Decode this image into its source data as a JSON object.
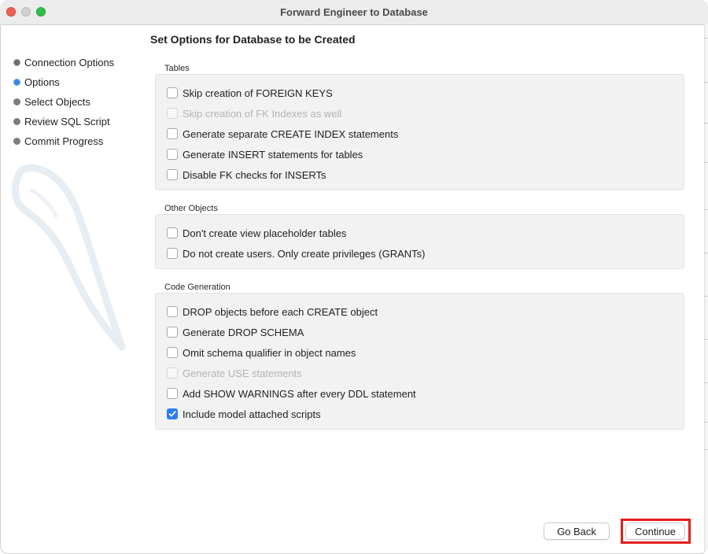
{
  "window": {
    "title": "Forward Engineer to Database"
  },
  "sidebar": {
    "steps": [
      {
        "label": "Connection Options",
        "state": "done"
      },
      {
        "label": "Options",
        "state": "current"
      },
      {
        "label": "Select Objects",
        "state": "pending"
      },
      {
        "label": "Review SQL Script",
        "state": "pending"
      },
      {
        "label": "Commit Progress",
        "state": "pending"
      }
    ]
  },
  "main": {
    "heading": "Set Options for Database to be Created",
    "sections": [
      {
        "label": "Tables",
        "options": [
          {
            "label": "Skip creation of FOREIGN KEYS",
            "checked": false,
            "enabled": true
          },
          {
            "label": "Skip creation of FK Indexes as well",
            "checked": false,
            "enabled": false
          },
          {
            "label": "Generate separate CREATE INDEX statements",
            "checked": false,
            "enabled": true
          },
          {
            "label": "Generate INSERT statements for tables",
            "checked": false,
            "enabled": true
          },
          {
            "label": "Disable FK checks for INSERTs",
            "checked": false,
            "enabled": true
          }
        ]
      },
      {
        "label": "Other Objects",
        "options": [
          {
            "label": "Don't create view placeholder tables",
            "checked": false,
            "enabled": true
          },
          {
            "label": "Do not create users. Only create privileges (GRANTs)",
            "checked": false,
            "enabled": true
          }
        ]
      },
      {
        "label": "Code Generation",
        "options": [
          {
            "label": "DROP objects before each CREATE object",
            "checked": false,
            "enabled": true
          },
          {
            "label": "Generate DROP SCHEMA",
            "checked": false,
            "enabled": true
          },
          {
            "label": "Omit schema qualifier in object names",
            "checked": false,
            "enabled": true
          },
          {
            "label": "Generate USE statements",
            "checked": false,
            "enabled": false
          },
          {
            "label": "Add SHOW WARNINGS after every DDL statement",
            "checked": false,
            "enabled": true
          },
          {
            "label": "Include model attached scripts",
            "checked": true,
            "enabled": true
          }
        ]
      }
    ]
  },
  "footer": {
    "back_label": "Go Back",
    "continue_label": "Continue"
  },
  "colors": {
    "accent": "#2b7ef0",
    "current_step": "#3d86e0",
    "highlight": "#e41e1e"
  }
}
